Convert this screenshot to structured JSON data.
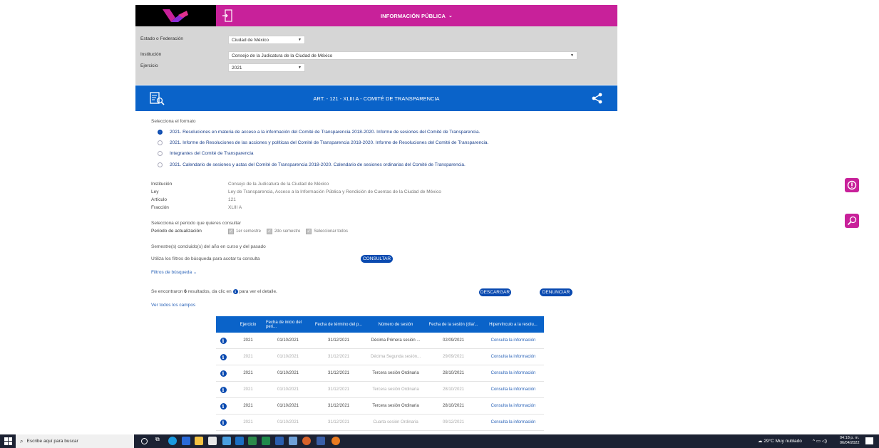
{
  "header": {
    "title": "INFORMACIÓN PÚBLICA",
    "chevron": "⌄"
  },
  "filters": {
    "estado_label": "Estado o Federación",
    "estado_value": "Ciudad de México",
    "institucion_label": "Institución",
    "institucion_value": "Consejo de la Judicatura de la Ciudad de México",
    "ejercicio_label": "Ejercicio",
    "ejercicio_value": "2021"
  },
  "article_bar": {
    "title": "ART. - 121 - XLIII A - COMITÉ DE TRANSPARENCIA"
  },
  "formats": {
    "label": "Selecciona el formato",
    "options": [
      {
        "text": "2021. Resoluciones en materia de acceso a la información del Comité de Transparencia 2018-2020. Informe de sesiones del Comité de Transparencia.",
        "selected": true
      },
      {
        "text": "2021. Informe de Resoluciones de las acciones y políticas del Comité de Transparencia 2018-2020. Informe de Resoluciones del Comité de Transparencia.",
        "selected": false
      },
      {
        "text": "Integrantes del Comité de Transparencia",
        "selected": false
      },
      {
        "text": "2021. Calendario de sesiones y actas del Comité de Transparencia 2018-2020. Calendario de sesiones ordinarias del Comité de Transparencia.",
        "selected": false
      }
    ]
  },
  "details": {
    "institucion_label": "Institución",
    "institucion_value": "Consejo de la Judicatura de la Ciudad de México",
    "ley_label": "Ley",
    "ley_value": "Ley de Transparencia, Acceso a la Información Pública y Rendición de Cuentas de la Ciudad de México",
    "articulo_label": "Artículo",
    "articulo_value": "121",
    "fraccion_label": "Fracción",
    "fraccion_value": "XLIII A"
  },
  "period": {
    "prompt": "Selecciona el periodo que quieres consultar",
    "label": "Periodo de actualización",
    "opt1": "1er semestre",
    "opt2": "2do semestre",
    "opt3": "Seleccionar todos",
    "note": "Semestre(s) concluido(s) del año en curso y del pasado"
  },
  "search": {
    "hint": "Utiliza los filtros de búsqueda para acotar tu consulta",
    "consult_btn": "CONSULTAR",
    "filters_link": "Filtros de búsqueda",
    "filters_chev": "⌄"
  },
  "results": {
    "text_pre": "Se encontraron ",
    "count": "6",
    "text_mid": " resultados, da clic en ",
    "text_post": " para ver el detalle.",
    "download_btn": "DESCARGAR",
    "report_btn": "DENUNCIAR",
    "all_fields_link": "Ver todos los campos"
  },
  "table": {
    "headers": [
      "Ejercicio",
      "Fecha de inicio del peri...",
      "Fecha de término del p...",
      "Número de sesión",
      "Fecha de la sesión (día/...",
      "Hipervínculo a la resolu..."
    ],
    "rows": [
      {
        "ejercicio": "2021",
        "inicio": "01/10/2021",
        "termino": "31/12/2021",
        "sesion": "Décima Primera sesión ...",
        "fecha": "02/09/2021",
        "link": "Consulta la información",
        "faded": false
      },
      {
        "ejercicio": "2021",
        "inicio": "01/10/2021",
        "termino": "31/12/2021",
        "sesion": "Décima Segunda sesión...",
        "fecha": "29/09/2021",
        "link": "Consulta la información",
        "faded": true
      },
      {
        "ejercicio": "2021",
        "inicio": "01/10/2021",
        "termino": "31/12/2021",
        "sesion": "Tercera sesión Ordinaria",
        "fecha": "28/10/2021",
        "link": "Consulta la información",
        "faded": false
      },
      {
        "ejercicio": "2021",
        "inicio": "01/10/2021",
        "termino": "31/12/2021",
        "sesion": "Tercera sesión Ordinaria",
        "fecha": "28/10/2021",
        "link": "Consulta la información",
        "faded": true
      },
      {
        "ejercicio": "2021",
        "inicio": "01/10/2021",
        "termino": "31/12/2021",
        "sesion": "Tercera sesión Ordinaria",
        "fecha": "28/10/2021",
        "link": "Consulta la información",
        "faded": false
      },
      {
        "ejercicio": "2021",
        "inicio": "01/10/2021",
        "termino": "31/12/2021",
        "sesion": "Cuarta sesión Ordinaria",
        "fecha": "09/12/2021",
        "link": "Consulta la información",
        "faded": true
      }
    ]
  },
  "taskbar": {
    "search_placeholder": "Escribe aquí para buscar",
    "weather": "29°C  Muy nublado",
    "time": "04:18 p. m.",
    "date": "06/04/2022"
  },
  "colors": {
    "magenta": "#c8219a",
    "blue": "#0a63c9",
    "gray_panel": "#d6d6d6"
  }
}
